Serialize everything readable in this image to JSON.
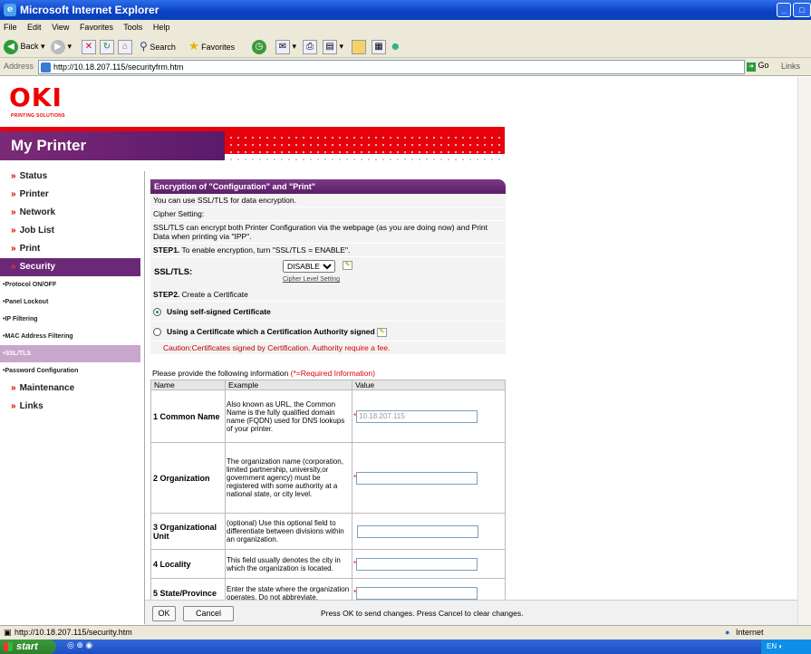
{
  "window": {
    "title": "Microsoft Internet Explorer"
  },
  "menu": [
    "File",
    "Edit",
    "View",
    "Favorites",
    "Tools",
    "Help"
  ],
  "toolbar": {
    "back": "Back",
    "search": "Search",
    "favorites": "Favorites"
  },
  "address": {
    "label": "Address",
    "url": "http://10.18.207.115/securityfrm.htm",
    "go": "Go",
    "links": "Links"
  },
  "brand": {
    "logo": "OKI",
    "sub": "PRINTING SOLUTIONS",
    "title": "My Printer"
  },
  "nav": [
    {
      "label": "Status"
    },
    {
      "label": "Printer"
    },
    {
      "label": "Network"
    },
    {
      "label": "Job List"
    },
    {
      "label": "Print"
    },
    {
      "label": "Security"
    }
  ],
  "subnav": [
    "•Protocol ON/OFF",
    "•Panel Lockout",
    "•IP Filtering",
    "•MAC Address Filtering",
    "•SSL/TLS",
    "•Password Configuration"
  ],
  "nav2": [
    {
      "label": "Maintenance"
    },
    {
      "label": "Links"
    }
  ],
  "main": {
    "header": "Encryption of \"Configuration\" and \"Print\"",
    "intro": "You can use SSL/TLS for data encryption.",
    "cipher": "Cipher Setting:",
    "desc": "SSL/TLS can encrypt both Printer Configuration via the webpage (as you are doing now) and Print Data when printing via \"IPP\".",
    "step1_label": "STEP1.",
    "step1_text": " To enable encryption, turn \"SSL/TLS = ENABLE\".",
    "ssl_label": "SSL/TLS:",
    "ssl_value": "DISABLE",
    "cipher_link": "Cipher Level Setting",
    "step2_label": "STEP2.",
    "step2_text": " Create a Certificate",
    "opt1": "Using self-signed Certificate",
    "opt2": "Using a Certificate which a Certification Authority signed",
    "caution_a": "Caution:Certificates signed by Certification. Authority ",
    "caution_b": "require a fee.",
    "provide": "Please provide the following information ",
    "provide_req": "(*=Required Information)",
    "cols": {
      "name": "Name",
      "example": "Example",
      "value": "Value"
    },
    "rows": [
      {
        "num": "1",
        "name": "Common Name",
        "example": "Also known as URL, the Common Name is the fully qualified domain name (FQDN) used for DNS lookups of your printer.",
        "value": "10.18.207.115",
        "req": "*"
      },
      {
        "num": "2",
        "name": "Organization",
        "example": "The organization name (corporation, limited partnership, university,or government agency) must be registered with some authority at a national state, or city level.",
        "value": "",
        "req": "*"
      },
      {
        "num": "3",
        "name": "Organizational Unit",
        "example": "(optional) Use this optional field to differentiate between divisions within an organization.",
        "value": "",
        "req": ""
      },
      {
        "num": "4",
        "name": "Locality",
        "example": "This field usually denotes the city in which the organization is located.",
        "value": "",
        "req": "*"
      },
      {
        "num": "5",
        "name": "State/Province",
        "example": "Enter the state where the organization operates. Do not abbreviate.",
        "value": "",
        "req": "*"
      }
    ]
  },
  "buttons": {
    "ok": "OK",
    "cancel": "Cancel",
    "hint": "Press OK to send changes. Press Cancel to clear changes."
  },
  "status": {
    "url": "http://10.18.207.115/security.htm",
    "zone": "Internet"
  },
  "taskbar": {
    "start": "start",
    "tray": "EN"
  }
}
